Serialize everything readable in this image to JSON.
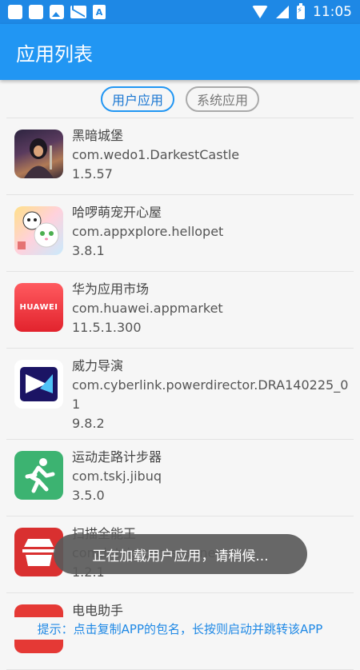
{
  "status_bar": {
    "time": "11:05",
    "letter_icon": "A",
    "icons": [
      "square-icon",
      "square-icon",
      "photo-icon",
      "mail-icon",
      "a-letter-icon"
    ],
    "right_icons": [
      "wifi-icon",
      "signal-icon",
      "battery-charging-icon"
    ]
  },
  "appbar": {
    "title": "应用列表"
  },
  "tabs": [
    {
      "label": "用户应用",
      "active": true
    },
    {
      "label": "系统应用",
      "active": false
    }
  ],
  "apps": [
    {
      "name": "黑暗城堡",
      "package": "com.wedo1.DarkestCastle",
      "version": "1.5.57",
      "icon": "darkest-castle-icon"
    },
    {
      "name": "哈啰萌宠开心屋",
      "package": "com.appxplore.hellopet",
      "version": "3.8.1",
      "icon": "hellopet-icon"
    },
    {
      "name": "华为应用市场",
      "package": "com.huawei.appmarket",
      "version": "11.5.1.300",
      "icon": "huawei-appmarket-icon",
      "icon_text": "HUAWEI"
    },
    {
      "name": "威力导演",
      "package": "com.cyberlink.powerdirector.DRA140225_01",
      "version": "9.8.2",
      "icon": "powerdirector-icon"
    },
    {
      "name": "运动走路计步器",
      "package": "com.tskj.jibuq",
      "version": "3.5.0",
      "icon": "pedometer-icon"
    },
    {
      "name": "扫描全能王",
      "package": "com.intsig.camscanner",
      "version": "1.2.1",
      "icon": "scanner-icon"
    },
    {
      "name": "电电助手",
      "package": "",
      "version": "",
      "icon": "app-icon"
    }
  ],
  "toast": {
    "text": "正在加载用户应用，请稍候..."
  },
  "tip": {
    "text": "提示：点击复制APP的包名，长按则启动并跳转该APP"
  },
  "colors": {
    "primary": "#2196f3",
    "status_bar": "#1e88e5",
    "tip_text": "#1e88e5"
  }
}
